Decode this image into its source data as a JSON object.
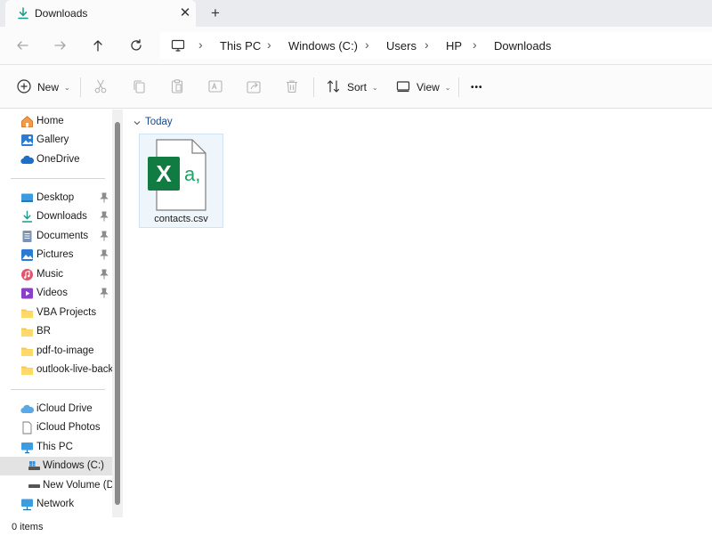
{
  "tab": {
    "title": "Downloads",
    "icon": "download-icon",
    "close_glyph": "✕"
  },
  "new_tab_glyph": "+",
  "nav": {
    "back_icon": "back-arrow-icon",
    "forward_icon": "forward-arrow-icon",
    "up_icon": "up-arrow-icon",
    "refresh_icon": "refresh-icon"
  },
  "address": {
    "root_icon": "this-pc-icon",
    "crumbs": [
      "This PC",
      "Windows (C:)",
      "Users",
      "HP",
      "Downloads"
    ],
    "separator": "›"
  },
  "toolbar": {
    "new_label": "New",
    "sort_label": "Sort",
    "view_label": "View",
    "more_glyph": "•••",
    "chevron": "⌄",
    "icons": [
      "new-plus-icon",
      "cut-icon",
      "copy-icon",
      "paste-icon",
      "rename-icon",
      "share-icon",
      "delete-icon",
      "sort-icon",
      "view-icon",
      "more-icon"
    ]
  },
  "sidebar": {
    "quick": [
      {
        "label": "Home",
        "icon": "home-icon"
      },
      {
        "label": "Gallery",
        "icon": "gallery-icon"
      },
      {
        "label": "OneDrive",
        "icon": "onedrive-cloud-icon"
      }
    ],
    "pinned": [
      {
        "label": "Desktop",
        "icon": "desktop-icon",
        "pinned": true
      },
      {
        "label": "Downloads",
        "icon": "downloads-icon",
        "pinned": true
      },
      {
        "label": "Documents",
        "icon": "documents-icon",
        "pinned": true
      },
      {
        "label": "Pictures",
        "icon": "pictures-icon",
        "pinned": true
      },
      {
        "label": "Music",
        "icon": "music-icon",
        "pinned": true
      },
      {
        "label": "Videos",
        "icon": "videos-icon",
        "pinned": true
      },
      {
        "label": "VBA Projects",
        "icon": "folder-icon",
        "pinned": false
      },
      {
        "label": "BR",
        "icon": "folder-icon",
        "pinned": false
      },
      {
        "label": "pdf-to-image",
        "icon": "folder-icon",
        "pinned": false
      },
      {
        "label": "outlook-live-back",
        "icon": "folder-icon",
        "pinned": false
      }
    ],
    "devices": [
      {
        "label": "iCloud Drive",
        "icon": "icloud-drive-icon"
      },
      {
        "label": "iCloud Photos",
        "icon": "icloud-photos-icon"
      },
      {
        "label": "This PC",
        "icon": "this-pc-icon"
      },
      {
        "label": "Windows (C:)",
        "icon": "drive-c-icon",
        "selected": true
      },
      {
        "label": "New Volume (D:",
        "icon": "drive-d-icon"
      },
      {
        "label": "Network",
        "icon": "network-icon"
      }
    ]
  },
  "content": {
    "group_title": "Today",
    "files": [
      {
        "name": "contacts.csv",
        "icon": "excel-csv-file-icon",
        "badge_letter": "X",
        "badge_text": "a,"
      }
    ]
  },
  "status": {
    "item_count": "0 items"
  },
  "colors": {
    "accent": "#0067c0",
    "excel_green": "#107c41",
    "csv_teal": "#21a366",
    "folder_yellow": "#f7c948"
  }
}
